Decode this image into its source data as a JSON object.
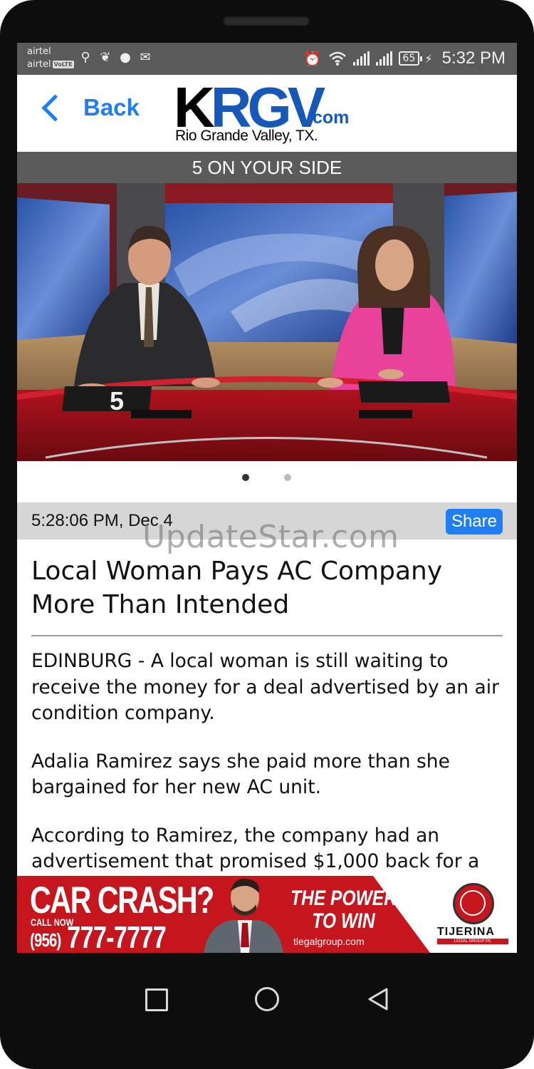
{
  "status_bar": {
    "carrier_1": "airtel",
    "carrier_2": "airtel",
    "volte_badge": "VoLTE",
    "battery_level": "65",
    "time": "5:32 PM",
    "left_icons": [
      "usb-icon",
      "feather-icon",
      "chat-icon",
      "mail-settings-icon"
    ],
    "right_icons": [
      "alarm-icon",
      "wifi-icon",
      "signal-icon",
      "signal-icon",
      "battery-icon",
      "charging-icon"
    ]
  },
  "header": {
    "back_label": "Back",
    "logo_k": "K",
    "logo_rgv": "RGV",
    "logo_com": ".com",
    "logo_tagline": "Rio Grande Valley, TX."
  },
  "section": {
    "title": "5 ON YOUR SIDE"
  },
  "hero": {
    "desk_number": "5",
    "carousel_count": 2,
    "carousel_active_index": 0
  },
  "article": {
    "timestamp": "5:28:06 PM, Dec 4",
    "share_label": "Share",
    "headline": "Local Woman Pays AC Company More Than Intended",
    "paragraphs": [
      "EDINBURG - A local woman is still waiting to receive the money for a deal advertised by an air condition company.",
      "Adalia Ramirez says she paid more than she bargained for her new AC unit.",
      "According to Ramirez, the company had an advertisement that promised $1,000 back for a"
    ]
  },
  "watermark": "UpdateStar.com",
  "ad": {
    "headline": "CAR CRASH?",
    "call_now": "CALL NOW",
    "area_code": "(956)",
    "phone": "777-7777",
    "slogan_1": "THE POWER",
    "slogan_2": "TO WIN",
    "url": "tlegalgroup.com",
    "firm": "TIJERINA",
    "firm_sub": "LEGAL GROUP PC"
  },
  "colors": {
    "accent_blue": "#1d7ff0",
    "logo_blue": "#1558b8",
    "section_gray": "#5b5b5b",
    "ad_red": "#c5161d"
  }
}
